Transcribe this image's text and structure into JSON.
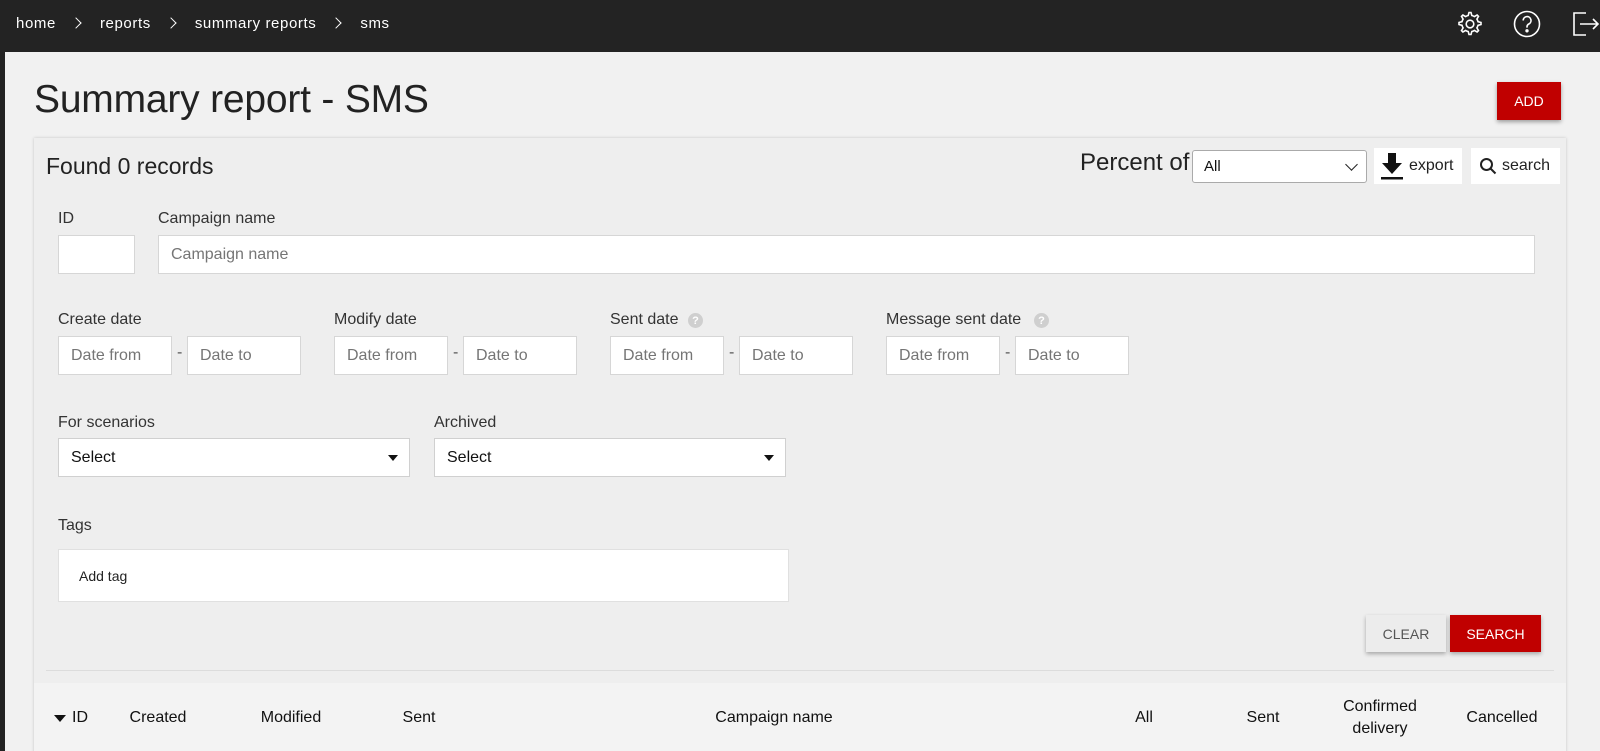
{
  "breadcrumb": [
    "home",
    "reports",
    "summary reports",
    "sms"
  ],
  "page": {
    "title": "Summary report - SMS",
    "add_label": "ADD"
  },
  "results": {
    "found_text": "Found 0 records",
    "percent_label": "Percent of",
    "percent_value": "All",
    "export_label": "export",
    "search_label": "search"
  },
  "filters": {
    "id_label": "ID",
    "campaign_label": "Campaign name",
    "campaign_placeholder": "Campaign name",
    "create_date_label": "Create date",
    "modify_date_label": "Modify date",
    "sent_date_label": "Sent date",
    "message_sent_date_label": "Message sent date",
    "date_from": "Date from",
    "date_to": "Date to",
    "date_separator": "-",
    "help_glyph": "?",
    "scenarios_label": "For scenarios",
    "scenarios_value": "Select",
    "archived_label": "Archived",
    "archived_value": "Select",
    "tags_label": "Tags",
    "tags_placeholder": "Add tag",
    "clear_label": "CLEAR",
    "search_label": "SEARCH"
  },
  "table": {
    "columns": [
      "ID",
      "Created",
      "Modified",
      "Sent",
      "Campaign name",
      "All",
      "Sent",
      "Confirmed delivery",
      "Cancelled"
    ]
  },
  "icons": {
    "settings": "gear-icon",
    "help": "question-circle-icon",
    "logout": "logout-icon",
    "export": "download-icon",
    "search": "magnifier-icon"
  },
  "colors": {
    "topbar": "#232323",
    "accent": "#c00000",
    "background": "#f1f1f1"
  }
}
